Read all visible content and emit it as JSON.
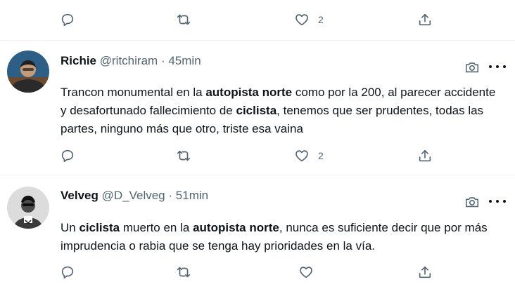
{
  "top_partial": {
    "like_count": "2"
  },
  "tweets": [
    {
      "name": "Richie",
      "handle": "@ritchiram",
      "separator": "·",
      "time": "45min",
      "text_parts": [
        {
          "t": "Trancon monumental en la ",
          "b": false
        },
        {
          "t": "autopista norte",
          "b": true
        },
        {
          "t": " como por la 200, al parecer accidente y desafortunado fallecimiento de ",
          "b": false
        },
        {
          "t": "ciclista",
          "b": true
        },
        {
          "t": ", tenemos que ser prudentes, todas las partes, ninguno más que otro, triste esa vaina",
          "b": false
        }
      ],
      "reply_count": "",
      "retweet_count": "",
      "like_count": "2"
    },
    {
      "name": "Velveg",
      "handle": "@D_Velveg",
      "separator": "·",
      "time": "51min",
      "text_parts": [
        {
          "t": "Un ",
          "b": false
        },
        {
          "t": "ciclista",
          "b": true
        },
        {
          "t": " muerto en la ",
          "b": false
        },
        {
          "t": "autopista norte",
          "b": true
        },
        {
          "t": ", nunca es suficiente decir que por más imprudencia o rabia que se tenga hay prioridades en la vía.",
          "b": false
        }
      ],
      "reply_count": "",
      "retweet_count": "",
      "like_count": ""
    }
  ],
  "icons": {
    "reply": "reply-icon",
    "retweet": "retweet-icon",
    "like": "heart-icon",
    "share": "share-icon",
    "media": "camera-icon",
    "more": "more-icon"
  },
  "colors": {
    "text": "#0f1419",
    "secondary": "#536471",
    "divider": "#eff3f4"
  }
}
